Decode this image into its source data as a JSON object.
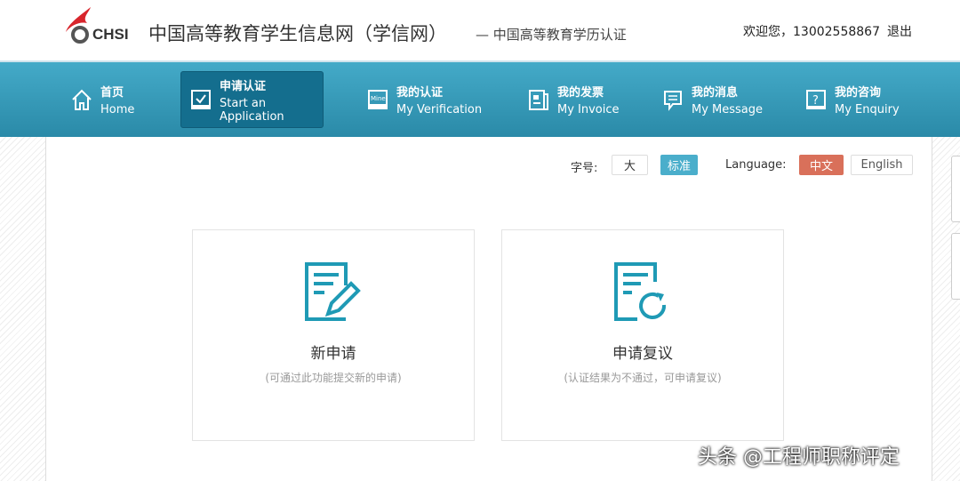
{
  "header": {
    "logo_text": "CHSI",
    "title": "中国高等教育学生信息网（学信网）",
    "subtitle": "— 中国高等教育学历认证",
    "user": "欢迎您，13002558867",
    "logout": "退出"
  },
  "nav": [
    {
      "cn": "首页",
      "en": "Home",
      "icon": "home-icon"
    },
    {
      "cn": "申请认证",
      "en": "Start an Application",
      "icon": "check-icon"
    },
    {
      "cn": "我的认证",
      "en": "My Verification",
      "icon": "mine-icon"
    },
    {
      "cn": "我的发票",
      "en": "My Invoice",
      "icon": "invoice-icon"
    },
    {
      "cn": "我的消息",
      "en": "My Message",
      "icon": "message-icon"
    },
    {
      "cn": "我的咨询",
      "en": "My Enquiry",
      "icon": "question-icon"
    }
  ],
  "toolbar": {
    "font_label": "字号:",
    "font_large": "大",
    "font_standard": "标准",
    "lang_label": "Language:",
    "lang_cn": "中文",
    "lang_en": "English"
  },
  "cards": [
    {
      "title": "新申请",
      "desc": "(可通过此功能提交新的申请)",
      "icon": "edit-document-icon"
    },
    {
      "title": "申请复议",
      "desc": "(认证结果为不通过，可申请复议)",
      "icon": "refresh-document-icon"
    }
  ],
  "watermark": "头条 @工程师职称评定",
  "colors": {
    "accent": "#2a9ab8",
    "active": "#146e8e",
    "lang_active": "#d9705a"
  }
}
